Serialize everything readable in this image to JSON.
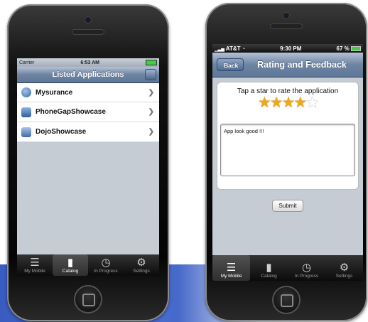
{
  "left_phone": {
    "status": {
      "carrier": "Carrier",
      "time": "6:53 AM"
    },
    "nav_title": "Listed Applications",
    "items": [
      {
        "label": "Mysurance",
        "icon": "globe-icon"
      },
      {
        "label": "PhoneGapShowcase",
        "icon": "monitor-icon"
      },
      {
        "label": "DojoShowcase",
        "icon": "window-icon"
      }
    ],
    "tabs": [
      {
        "label": "My Mobile",
        "icon": "list-icon"
      },
      {
        "label": "Catalog",
        "icon": "phone-icon"
      },
      {
        "label": "In Progress",
        "icon": "clock-icon"
      },
      {
        "label": "Settings",
        "icon": "gear-icon"
      }
    ],
    "active_tab": "Catalog"
  },
  "right_phone": {
    "status": {
      "carrier": "AT&T",
      "time": "9:30 PM",
      "battery": "67 %"
    },
    "back_label": "Back",
    "nav_title": "Rating and Feedback",
    "rating_prompt": "Tap a star to rate the application",
    "rating": 4,
    "rating_max": 5,
    "feedback_text": "App look good !!!",
    "submit_label": "Submit",
    "tabs": [
      {
        "label": "My Mobile",
        "icon": "list-icon"
      },
      {
        "label": "Catalog",
        "icon": "phone-icon"
      },
      {
        "label": "In Progress",
        "icon": "clock-icon"
      },
      {
        "label": "Settings",
        "icon": "gear-icon"
      }
    ],
    "active_tab": "My Mobile"
  },
  "colors": {
    "nav_blue": "#6d84a2",
    "star_gold": "#f0a818",
    "background_band": "#3a5bbf"
  }
}
